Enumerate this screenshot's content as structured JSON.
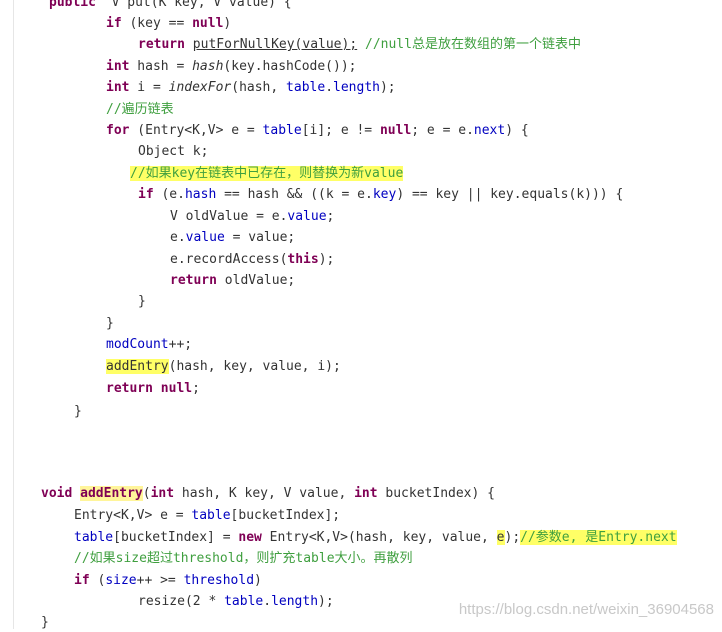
{
  "code": {
    "lines": [
      [
        [
          "kw",
          "public"
        ],
        [
          "",
          "  V put(K key, V value) {"
        ]
      ],
      [
        [
          "kw",
          "if"
        ],
        [
          "",
          " (key == "
        ],
        [
          "kw",
          "null"
        ],
        [
          "",
          ")"
        ]
      ],
      [
        [
          "kw",
          "return"
        ],
        [
          "",
          " "
        ],
        [
          "ul",
          "putForNullKey(value);"
        ],
        [
          "",
          " "
        ],
        [
          "cmt",
          "//null总是放在数组的第一个链表中"
        ]
      ],
      [
        [
          "kw",
          "int"
        ],
        [
          "",
          " hash = "
        ],
        [
          "it",
          "hash"
        ],
        [
          "",
          "(key.hashCode());"
        ]
      ],
      [
        [
          "kw",
          "int"
        ],
        [
          "",
          " i = "
        ],
        [
          "it",
          "indexFor"
        ],
        [
          "",
          "(hash, "
        ],
        [
          "fld",
          "table"
        ],
        [
          "",
          "."
        ],
        [
          "fld",
          "length"
        ],
        [
          "",
          ");"
        ]
      ],
      [
        [
          "cmt",
          "//遍历链表"
        ]
      ],
      [
        [
          "kw",
          "for"
        ],
        [
          "",
          " (Entry<K,V> e = "
        ],
        [
          "fld",
          "table"
        ],
        [
          "",
          "[i]; e != "
        ],
        [
          "kw",
          "null"
        ],
        [
          "",
          "; e = e."
        ],
        [
          "fld",
          "next"
        ],
        [
          "",
          ") {"
        ]
      ],
      [
        [
          "",
          "Object k;"
        ]
      ],
      [
        [
          "cmt hl",
          "//如果key在链表中已存在，则替换为新value"
        ]
      ],
      [
        [
          "kw",
          "if"
        ],
        [
          "",
          " (e."
        ],
        [
          "fld",
          "hash"
        ],
        [
          "",
          " == hash && ((k = e."
        ],
        [
          "fld",
          "key"
        ],
        [
          "",
          ") == key || key.equals(k))) {"
        ]
      ],
      [
        [
          "",
          "V oldValue = e."
        ],
        [
          "fld",
          "value"
        ],
        [
          "",
          ";"
        ]
      ],
      [
        [
          "",
          "e."
        ],
        [
          "fld",
          "value"
        ],
        [
          "",
          " = value;"
        ]
      ],
      [
        [
          "",
          "e.recordAccess("
        ],
        [
          "kw",
          "this"
        ],
        [
          "",
          ");"
        ]
      ],
      [
        [
          "kw",
          "return"
        ],
        [
          "",
          " oldValue;"
        ]
      ],
      [
        [
          "",
          "}"
        ]
      ],
      [
        [
          "",
          "}"
        ]
      ],
      [
        [
          "fld",
          "modCount"
        ],
        [
          "",
          "++;"
        ]
      ],
      [
        [
          "hl",
          "addEntry"
        ],
        [
          "",
          "(hash, key, value, i);"
        ]
      ],
      [
        [
          "kw",
          "return"
        ],
        [
          "",
          " "
        ],
        [
          "kw",
          "null"
        ],
        [
          "",
          ";"
        ]
      ],
      [
        [
          "",
          "}"
        ]
      ],
      [
        [
          "kw",
          "void"
        ],
        [
          "",
          " "
        ],
        [
          "kw hl2",
          "addEntry"
        ],
        [
          "",
          "("
        ],
        [
          "kw",
          "int"
        ],
        [
          "",
          " hash, K key, V value, "
        ],
        [
          "kw",
          "int"
        ],
        [
          "",
          " bucketIndex) {"
        ]
      ],
      [
        [
          "",
          "Entry<K,V> e = "
        ],
        [
          "fld",
          "table"
        ],
        [
          "",
          "[bucketIndex];"
        ]
      ],
      [
        [
          "fld",
          "table"
        ],
        [
          "",
          "[bucketIndex] = "
        ],
        [
          "kw",
          "new"
        ],
        [
          "",
          " Entry<K,V>(hash, key, value, "
        ],
        [
          "hl",
          "e"
        ],
        [
          "",
          ");"
        ],
        [
          "cmt hl",
          "//参数e, 是Entry.next"
        ]
      ],
      [
        [
          "cmt",
          "//如果size超过threshold，则扩充table大小。再散列"
        ]
      ],
      [
        [
          "kw",
          "if"
        ],
        [
          "",
          " ("
        ],
        [
          "fld",
          "size"
        ],
        [
          "",
          "++ >= "
        ],
        [
          "fld",
          "threshold"
        ],
        [
          "",
          ")"
        ]
      ],
      [
        [
          "",
          "resize(2 * "
        ],
        [
          "fld",
          "table"
        ],
        [
          "",
          "."
        ],
        [
          "fld",
          "length"
        ],
        [
          "",
          ");"
        ]
      ],
      [
        [
          "",
          "}"
        ]
      ]
    ]
  },
  "watermark": "https://blog.csdn.net/weixin_36904568"
}
